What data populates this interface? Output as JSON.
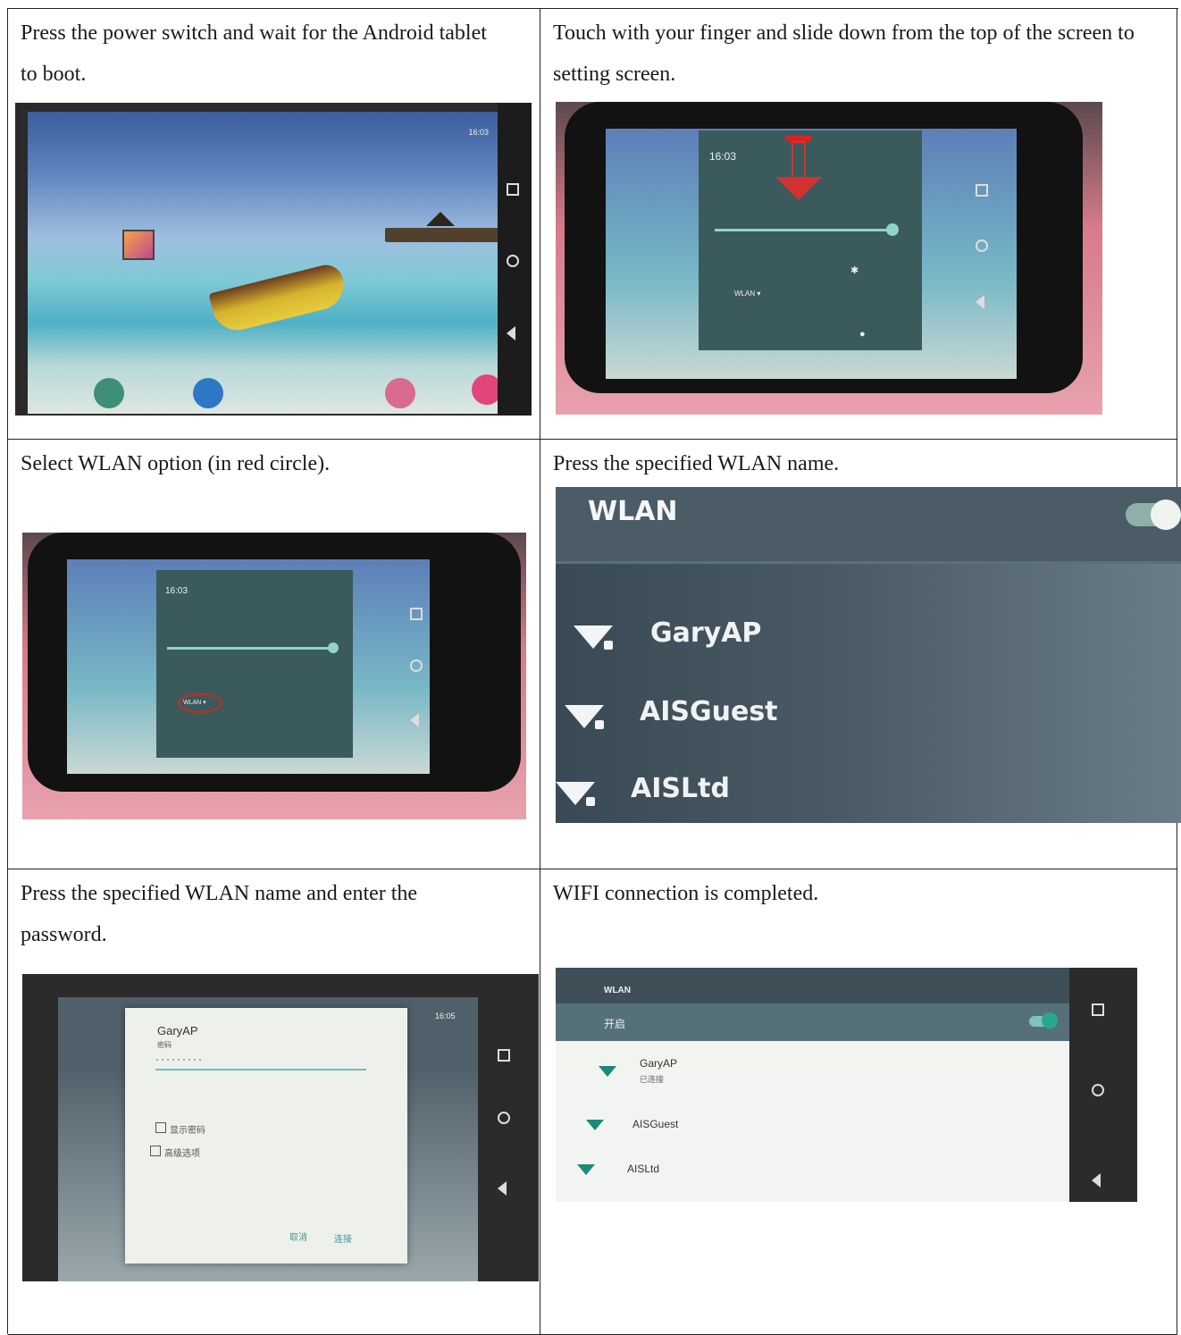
{
  "steps": [
    {
      "caption": "Press the power switch and wait for the Android tablet to boot.",
      "screen": {
        "status_time": "16:03"
      }
    },
    {
      "caption": "Touch with your finger and slide down from the top of the screen to setting screen.",
      "screen": {
        "time": "16:03",
        "wlan_tile": "WLAN ▾"
      }
    },
    {
      "caption": "Select WLAN option (in red circle).",
      "screen": {
        "time": "16:03",
        "wlan_tile": "WLAN ▾"
      }
    },
    {
      "caption": "Press the specified WLAN name.",
      "screen": {
        "title": "WLAN",
        "networks": [
          "GaryAP",
          "AISGuest",
          "AISLtd"
        ]
      }
    },
    {
      "caption": "Press the specified WLAN name and enter the password.",
      "screen": {
        "status_time": "16:05",
        "dialog_title": "GaryAP",
        "password_label": "密码",
        "password_mask": "·········",
        "show_password": "显示密码",
        "advanced": "高级选项",
        "cancel": "取消",
        "connect": "连接"
      }
    },
    {
      "caption": "WIFI connection is completed.",
      "screen": {
        "title": "WLAN",
        "on_label": "开启",
        "networks": [
          {
            "name": "GaryAP",
            "status": "已连接"
          },
          {
            "name": "AISGuest"
          },
          {
            "name": "AISLtd"
          }
        ]
      }
    }
  ]
}
